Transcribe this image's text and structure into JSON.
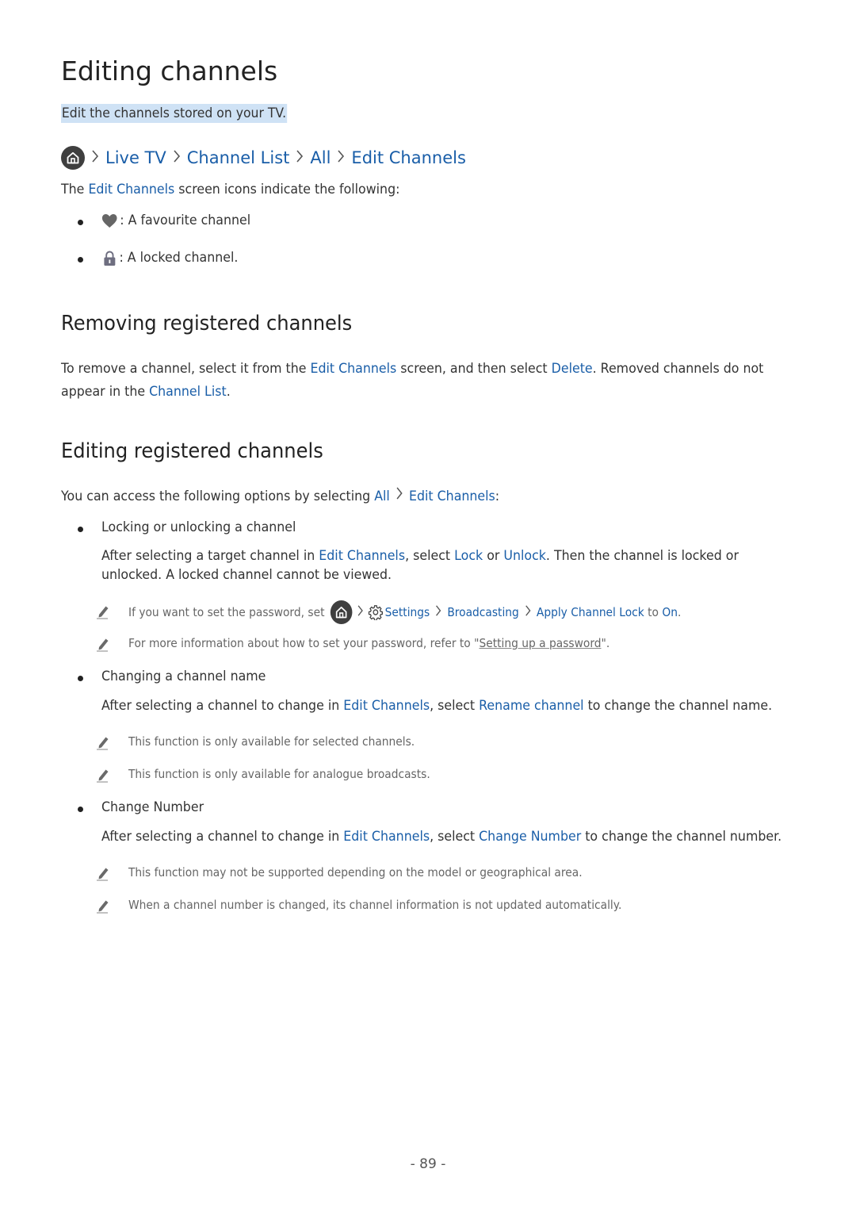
{
  "page": {
    "title": "Editing channels",
    "subtitle": "Edit the channels stored on your TV.",
    "page_number": "- 89 -"
  },
  "colors": {
    "link": "#1a5ea8",
    "text": "#333333",
    "note_text": "#666666",
    "highlight": "#cfe2f5",
    "icon_dark": "#3f3f3f"
  },
  "breadcrumb": {
    "icon": "home-icon",
    "items": [
      "Live TV",
      "Channel List",
      "All",
      "Edit Channels"
    ]
  },
  "intro": {
    "prefix": "The ",
    "link": "Edit Channels",
    "suffix": " screen icons indicate the following:",
    "icons": [
      {
        "icon": "heart-icon",
        "label": ": A favourite channel"
      },
      {
        "icon": "lock-icon",
        "label": ": A locked channel."
      }
    ]
  },
  "removing": {
    "heading": "Removing registered channels",
    "line1": {
      "t1": "To remove a channel, select it from the ",
      "l1": "Edit Channels",
      "t2": " screen, and then select ",
      "l2": "Delete",
      "t3": ". Removed channels do not"
    },
    "line2": {
      "t1": "appear in the ",
      "l1": "Channel List",
      "t2": "."
    }
  },
  "editing": {
    "heading": "Editing registered channels",
    "intro": {
      "t1": "You can access the following options by selecting ",
      "l1": "All",
      "l2": "Edit Channels",
      "t2": ":"
    },
    "lock": {
      "title": "Locking or unlocking a channel",
      "desc1": {
        "t1": "After selecting a target channel in ",
        "l1": "Edit Channels",
        "t2": ", select ",
        "l2": "Lock",
        "t3": " or ",
        "l3": "Unlock",
        "t4": ". Then the channel is locked or"
      },
      "desc2": "unlocked. A locked channel cannot be viewed.",
      "note1": {
        "t1": "If you want to set the password, set ",
        "settings": "Settings",
        "broadcasting": "Broadcasting",
        "apply": "Apply Channel Lock",
        "t2": " to ",
        "on": "On",
        "t3": "."
      },
      "note2": {
        "t1": "For more information about how to set your password, refer to \"",
        "link": "Setting up a password",
        "t2": "\"."
      }
    },
    "rename": {
      "title": "Changing a channel name",
      "desc": {
        "t1": "After selecting a channel to change in ",
        "l1": "Edit Channels",
        "t2": ", select ",
        "l2": "Rename channel",
        "t3": " to change the channel name."
      },
      "notes": [
        "This function is only available for selected channels.",
        "This function is only available for analogue broadcasts."
      ]
    },
    "number": {
      "title": "Change Number",
      "desc": {
        "t1": "After selecting a channel to change in ",
        "l1": "Edit Channels",
        "t2": ", select ",
        "l2": "Change Number",
        "t3": " to change the channel number."
      },
      "notes": [
        "This function may not be supported depending on the model or geographical area.",
        "When a channel number is changed, its channel information is not updated automatically."
      ]
    }
  }
}
